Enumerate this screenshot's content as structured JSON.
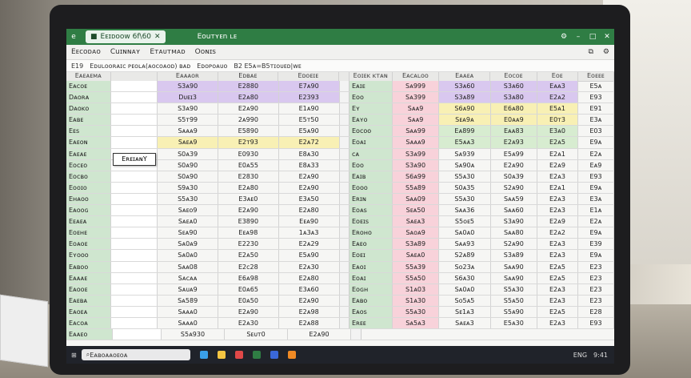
{
  "titlebar": {
    "app_icon": "e",
    "tab_label": "Eᴇɪᴅᴏᴏᴡ 6f\\60",
    "doc_title": "Eouᴛʏᴇn ʟᴇ",
    "right_icons": [
      "gear-icon",
      "minimize-icon",
      "maximize-icon",
      "close-icon"
    ]
  },
  "ribbon": {
    "items": [
      "Eᴇᴄᴏᴅᴀᴏ",
      "Cuɪɴɴᴀʏ",
      "Eᴛᴀᴜᴛᴍᴀᴅ",
      "Oᴏɴɪs"
    ]
  },
  "formulabar": {
    "cell_ref": "E19",
    "formula_text": "Eᴅᴜʟᴏᴏʀᴀɪᴄ ᴘᴇᴏʟᴀ(ᴀᴏᴄᴏᴀᴏᴅ) ʙᴀᴅ",
    "mid_text": "Eᴅᴏᴘᴏᴀᴜᴏ",
    "right_text": "B2 E5ᴀ=B5ᴛɪᴏᴜᴇᴅ|ᴡᴇ"
  },
  "left_headers": [
    "Eᴀᴇᴀᴇᴍᴀ",
    "Eᴀᴀᴀᴏʀ",
    "Eᴅʙᴀᴇ",
    "Eᴅᴏᴇɪᴇ",
    "Eᴅᴏɪᴇᴇ"
  ],
  "right_headers": [
    "Eᴏɪᴇᴋ ᴋᴛᴀɴ",
    "Eᴀᴄᴀʟᴏᴏ",
    "Eᴀᴀᴇᴀ",
    "Eᴏᴄᴏᴇ",
    "Eᴏᴇ",
    "Eᴏᴇᴇᴇ"
  ],
  "left_rows": [
    {
      "label": "Eᴀᴄᴏᴇ",
      "v1": "S3ᴀ90",
      "v2": "E2880",
      "v3": "E7ᴀ90",
      "tint": "purple"
    },
    {
      "label": "Dᴀᴏʀᴀ",
      "v1": "Dᴜᴇɪ3",
      "v2": "E2ᴀ80",
      "v3": "E2393",
      "tint": "purple"
    },
    {
      "label": "Dᴀᴏᴋᴏ",
      "v1": "S3ᴀ90",
      "v2": "E2ᴀ90",
      "v3": "E1ᴀ90",
      "tint": "white"
    },
    {
      "label": "Eᴀʙᴇ",
      "v1": "S5ᴛ99",
      "v2": "2ᴀ990",
      "v3": "E5ᴛ50",
      "tint": "white"
    },
    {
      "label": "Eᴇs",
      "v1": "Sᴀᴀᴀ9",
      "v2": "E5890",
      "v3": "E5ᴀ90",
      "tint": "white"
    },
    {
      "label": "Eᴀᴇᴏɴ",
      "v1": "Sᴀᴇᴀ9",
      "v2": "E2ᴛ93",
      "v3": "E2ᴀ72",
      "tint": "yellow"
    },
    {
      "label": "Eᴀᴇᴀᴇ",
      "v1": "S0ᴀ39",
      "v2": "E0930",
      "v3": "E8ᴀ30",
      "tint": "white"
    },
    {
      "label": "Eᴏᴄᴇᴏ",
      "v1": "S0ᴀ90",
      "v2": "E0ᴀ55",
      "v3": "E8ᴀ33",
      "tint": "white"
    },
    {
      "label": "Eᴏᴄʙᴏ",
      "v1": "S0ᴀ90",
      "v2": "E2830",
      "v3": "E2ᴀ90",
      "tint": "white"
    },
    {
      "label": "Eᴏᴏɪᴏ",
      "v1": "S9ᴀ30",
      "v2": "E2ᴀ80",
      "v3": "E2ᴀ90",
      "tint": "white"
    },
    {
      "label": "Eʜᴀᴏᴏ",
      "v1": "S5ᴀ30",
      "v2": "E3ᴀᴇ0",
      "v3": "E3ᴀ50",
      "tint": "white"
    },
    {
      "label": "Eᴀᴏᴏɢ",
      "v1": "Sᴀᴇᴏ9",
      "v2": "E2ᴀ90",
      "v3": "E2ᴀ80",
      "tint": "white"
    },
    {
      "label": "Eᴇᴀᴇᴀ",
      "v1": "Sᴀᴇᴀ0",
      "v2": "E3890",
      "v3": "Eᴇᴀ90",
      "tint": "white"
    },
    {
      "label": "Eᴏᴇʜᴇ",
      "v1": "Sᴇᴀ90",
      "v2": "Eᴇᴀ98",
      "v3": "1ᴀ3ᴀ3",
      "tint": "white"
    },
    {
      "label": "Eᴏᴀᴏᴇ",
      "v1": "Sᴀ0ᴀ9",
      "v2": "E2230",
      "v3": "E2ᴀ29",
      "tint": "white"
    },
    {
      "label": "Eʏᴏᴏᴏ",
      "v1": "Sᴀ0ᴀ0",
      "v2": "E2ᴀ50",
      "v3": "E5ᴀ90",
      "tint": "white"
    },
    {
      "label": "Eᴀʙᴏᴏ",
      "v1": "Sᴀᴀ08",
      "v2": "E2ᴄ28",
      "v3": "E2ᴀ30",
      "tint": "white"
    },
    {
      "label": "Eᴀᴀᴀᴇ",
      "v1": "Sᴀᴄᴀᴀ",
      "v2": "E6ᴀ98",
      "v3": "E2ᴀ80",
      "tint": "white"
    },
    {
      "label": "Eᴀᴏᴏᴇ",
      "v1": "Sᴀᴜᴀ9",
      "v2": "E0ᴀ65",
      "v3": "E3ᴀ60",
      "tint": "white"
    },
    {
      "label": "Eᴀᴇʙᴀ",
      "v1": "Sᴀ589",
      "v2": "E0ᴀ50",
      "v3": "E2ᴀ90",
      "tint": "white"
    },
    {
      "label": "Eᴀᴏᴇᴀ",
      "v1": "Sᴀᴀᴀ0",
      "v2": "E2ᴀ90",
      "v3": "E2ᴀ98",
      "tint": "white"
    },
    {
      "label": "Eᴀᴄᴏᴀ",
      "v1": "Sᴀᴀᴀ0",
      "v2": "E2ᴀ30",
      "v3": "E2ᴀ88",
      "tint": "white"
    },
    {
      "label": "Eᴀᴀᴇᴏ",
      "v1": "S5ᴀ930",
      "v2": "Sᴇᴜᴛ0",
      "v3": "E2ᴀ90",
      "tint": "white"
    }
  ],
  "right_rows": [
    {
      "label": "Eᴀɪᴇ",
      "v1": "Sᴀ999",
      "v2": "S3ᴀ60",
      "v3": "S3ᴀ60",
      "v4": "Eᴀᴀ3",
      "v5": "E5ᴀ",
      "tint": "purple"
    },
    {
      "label": "Eᴏᴏ",
      "v1": "Sᴀ399",
      "v2": "S3ᴀ89",
      "v3": "S3ᴀ80",
      "v4": "E2ᴀ2",
      "v5": "E93",
      "tint": "purple"
    },
    {
      "label": "Eʏ",
      "v1": "Sᴀᴀ9",
      "v2": "S6ᴀ90",
      "v3": "E6ᴀ80",
      "v4": "E5ᴀ1",
      "v5": "E91",
      "tint": "yellow"
    },
    {
      "label": "Eᴀʏᴏ",
      "v1": "Sᴀᴀ9",
      "v2": "Sᴇᴀ9ᴀ",
      "v3": "E0ᴀᴀ9",
      "v4": "E0ᴛ3",
      "v5": "E3ᴀ",
      "tint": "yellow"
    },
    {
      "label": "Eᴏᴄᴏᴏ",
      "v1": "Sᴀᴀ99",
      "v2": "Eᴀ899",
      "v3": "Eᴀᴀ83",
      "v4": "E3ᴀ0",
      "v5": "E03",
      "tint": "green"
    },
    {
      "label": "Eᴏᴀɪ",
      "v1": "Sᴀᴀᴀ9",
      "v2": "E5ᴀᴀ3",
      "v3": "E2ᴀ93",
      "v4": "E2ᴀ5",
      "v5": "E9ᴀ",
      "tint": "green"
    },
    {
      "label": "ᴄᴀ",
      "v1": "S3ᴀ99",
      "v2": "Sᴀ939",
      "v3": "E5ᴀ99",
      "v4": "E2ᴀ1",
      "v5": "E2ᴀ",
      "tint": "white"
    },
    {
      "label": "Eᴏᴏ",
      "v1": "S3ᴀ90",
      "v2": "Sᴀ90ᴀ",
      "v3": "E2ᴀ90",
      "v4": "E2ᴀ9",
      "v5": "Eᴀ9",
      "tint": "white"
    },
    {
      "label": "Eᴀɪʙ",
      "v1": "S6ᴀ99",
      "v2": "S5ᴀ30",
      "v3": "S0ᴀ39",
      "v4": "E2ᴀ3",
      "v5": "E93",
      "tint": "white"
    },
    {
      "label": "Eᴏᴏᴏ",
      "v1": "S5ᴀ89",
      "v2": "S0ᴀ35",
      "v3": "S2ᴀ90",
      "v4": "E2ᴀ1",
      "v5": "E9ᴀ",
      "tint": "white"
    },
    {
      "label": "Eʀɪɴ",
      "v1": "Sᴀᴀ09",
      "v2": "S5ᴀ30",
      "v3": "Sᴀᴀ59",
      "v4": "E2ᴀ3",
      "v5": "E3ᴀ",
      "tint": "white"
    },
    {
      "label": "Eᴏᴀs",
      "v1": "Sᴇᴀ50",
      "v2": "Sᴀᴀ36",
      "v3": "Sᴀᴀ60",
      "v4": "E2ᴀ3",
      "v5": "E1ᴀ",
      "tint": "white"
    },
    {
      "label": "Eᴏᴇɪs",
      "v1": "Sᴀᴇᴀ3",
      "v2": "S5ᴏᴇ5",
      "v3": "S3ᴀ90",
      "v4": "E2ᴀ9",
      "v5": "E2ᴀ",
      "tint": "white"
    },
    {
      "label": "Eʀᴏʜᴏ",
      "v1": "Sᴀᴏᴀ9",
      "v2": "Sᴀ0ᴀ0",
      "v3": "Sᴀᴀ80",
      "v4": "E2ᴀ2",
      "v5": "E9ᴀ",
      "tint": "white"
    },
    {
      "label": "Eᴀᴇᴏ",
      "v1": "S3ᴀ89",
      "v2": "Sᴀᴀ93",
      "v3": "S2ᴀ90",
      "v4": "E2ᴀ3",
      "v5": "E39",
      "tint": "white"
    },
    {
      "label": "Eᴏᴇɪ",
      "v1": "Sᴀᴇᴀ0",
      "v2": "S2ᴀ89",
      "v3": "S3ᴀ89",
      "v4": "E2ᴀ3",
      "v5": "E9ᴀ",
      "tint": "white"
    },
    {
      "label": "Eᴀᴏɪ",
      "v1": "S5ᴀ39",
      "v2": "Sᴏ23ᴀ",
      "v3": "Sᴀᴀ90",
      "v4": "E2ᴀ5",
      "v5": "E23",
      "tint": "white"
    },
    {
      "label": "Eᴏᴀɪ",
      "v1": "S5ᴀ50",
      "v2": "S6ᴀ30",
      "v3": "Sᴀᴀ90",
      "v4": "E2ᴀ5",
      "v5": "E23",
      "tint": "white"
    },
    {
      "label": "Eᴏɢʜ",
      "v1": "S1ᴀ03",
      "v2": "Sᴀ0ᴀ0",
      "v3": "S5ᴀ30",
      "v4": "E2ᴀ3",
      "v5": "E23",
      "tint": "white"
    },
    {
      "label": "Eᴀʙᴏ",
      "v1": "S1ᴀ30",
      "v2": "Sᴏ5ᴀ5",
      "v3": "S5ᴀ50",
      "v4": "E2ᴀ3",
      "v5": "E23",
      "tint": "white"
    },
    {
      "label": "Eᴀᴏs",
      "v1": "S5ᴀ30",
      "v2": "Sᴇ1ᴀ3",
      "v3": "S5ᴀ90",
      "v4": "E2ᴀ5",
      "v5": "E28",
      "tint": "white"
    },
    {
      "label": "Eʀᴇᴇ",
      "v1": "Sᴀ5ᴀ3",
      "v2": "Sᴀᴇᴀ3",
      "v3": "E5ᴀ30",
      "v4": "E2ᴀ3",
      "v5": "E93",
      "tint": "white"
    }
  ],
  "tooltip": {
    "text": "EʀᴇɪᴀɴY"
  },
  "taskbar": {
    "search_placeholder": "Eᴀʙᴏᴀᴀᴏᴇᴏᴀ",
    "tray_items": [
      "ENG",
      "9:41"
    ]
  },
  "colors": {
    "accent": "#2f7d44",
    "green_cell": "#cfe6cf",
    "pink": "#f8d2da",
    "purple": "#d9c8ef",
    "yellow": "#f8f0b4"
  }
}
